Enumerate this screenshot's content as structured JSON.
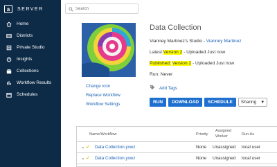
{
  "brand": {
    "mark": "a",
    "label": "SERVER"
  },
  "sidebar": {
    "items": [
      {
        "label": "Home",
        "icon": "home-icon"
      },
      {
        "label": "Districts",
        "icon": "districts-icon"
      },
      {
        "label": "Private Studio",
        "icon": "private-studio-icon"
      },
      {
        "label": "Insights",
        "icon": "insights-icon"
      },
      {
        "label": "Collections",
        "icon": "collections-icon"
      },
      {
        "label": "Workflow Results",
        "icon": "workflow-results-icon"
      },
      {
        "label": "Schedules",
        "icon": "schedules-icon"
      }
    ]
  },
  "search": {
    "placeholder": "Search"
  },
  "workflow": {
    "title": "Data Collection",
    "studio_prefix": "Vianney Martinez's Studio - ",
    "studio_owner": "Vianney Martinez",
    "latest_label": "Latest:",
    "latest_version": "Version 2",
    "latest_suffix": " - Uploaded Just now",
    "published_label": "Published:",
    "published_version": "Version 2",
    "published_suffix": " - Uploaded Just now",
    "run_label": "Run: Never"
  },
  "side_links": {
    "change_icon": "Change Icon",
    "replace_workflow": "Replace Workflow",
    "workflow_settings": "Workflow Settings"
  },
  "tags": {
    "add_label": "Add Tags"
  },
  "actions": {
    "run": "RUN",
    "download": "DOWNLOAD",
    "schedule": "SCHEDULE",
    "sharing": "Sharing"
  },
  "table": {
    "headers": {
      "name": "Name/Workflow",
      "priority": "Priority",
      "assigned_line1": "Assigned",
      "assigned_line2": "Worker",
      "run_as": "Run As"
    },
    "rows": [
      {
        "name": "Data Collection.yxwz",
        "priority": "None",
        "assigned": "Unassigned",
        "run_as": "local user"
      },
      {
        "name": "Data Collection.yxwz",
        "priority": "None",
        "assigned": "Unassigned",
        "run_as": "local user"
      }
    ]
  },
  "colors": {
    "sidebar": "#0d2a47",
    "accent": "#1e6fd0",
    "link": "#1e63b6",
    "highlight": "#ffff00"
  }
}
